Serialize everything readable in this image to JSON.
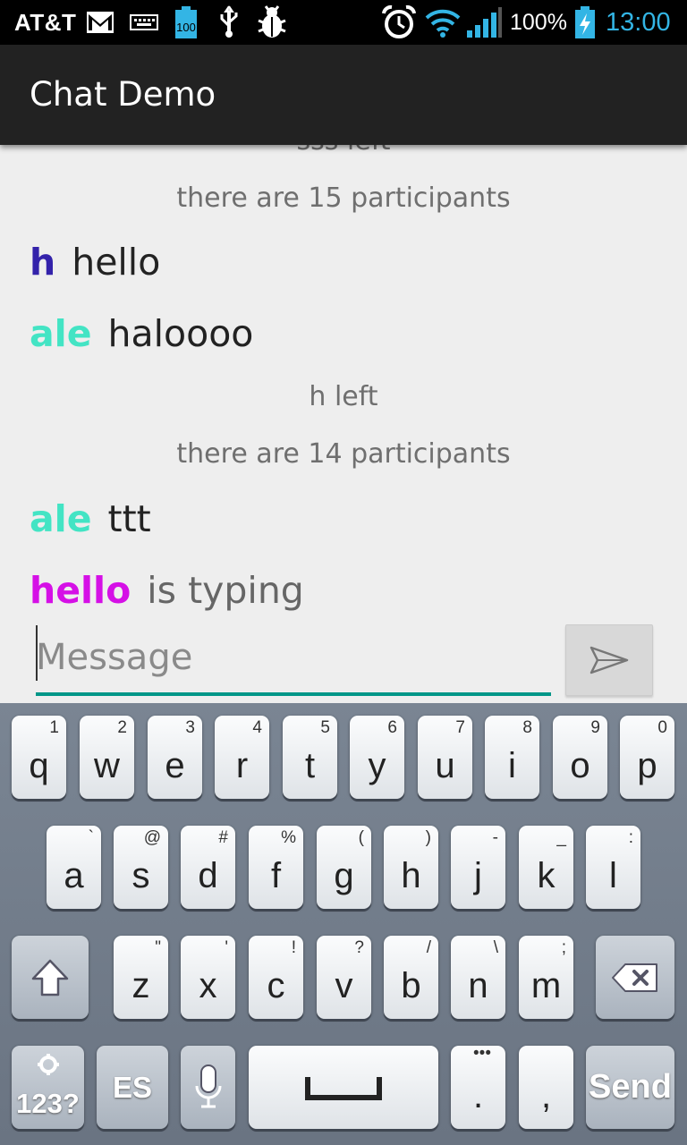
{
  "status_bar": {
    "carrier": "AT&T",
    "icons": [
      "gmail-icon",
      "keyboard-icon",
      "battery-100-icon",
      "usb-icon",
      "debug-icon",
      "alarm-icon",
      "wifi-icon",
      "signal-icon",
      "battery-charging-icon"
    ],
    "notification_battery_level": "100",
    "battery": "100%",
    "time": "13:00",
    "time_color": "#33b5e5"
  },
  "action_bar": {
    "title": "Chat Demo"
  },
  "chat": {
    "clipped_top": "sss left",
    "items": [
      {
        "type": "system",
        "text": "there are 15 participants"
      },
      {
        "type": "message",
        "user": "h",
        "user_color": "#3322aa",
        "text": "hello"
      },
      {
        "type": "message",
        "user": "ale",
        "user_color": "#43e4c4",
        "text": "haloooo"
      },
      {
        "type": "system",
        "text": "h left"
      },
      {
        "type": "system",
        "text": "there are 14 participants"
      },
      {
        "type": "message",
        "user": "ale",
        "user_color": "#43e4c4",
        "text": "ttt"
      }
    ],
    "typing": {
      "user": "hello",
      "user_color": "#d510e6",
      "text": "is typing"
    }
  },
  "composer": {
    "placeholder": "Message",
    "value": "",
    "send_icon": "send-icon"
  },
  "keyboard": {
    "row1": [
      {
        "main": "q",
        "sub": "1"
      },
      {
        "main": "w",
        "sub": "2"
      },
      {
        "main": "e",
        "sub": "3"
      },
      {
        "main": "r",
        "sub": "4"
      },
      {
        "main": "t",
        "sub": "5"
      },
      {
        "main": "y",
        "sub": "6"
      },
      {
        "main": "u",
        "sub": "7"
      },
      {
        "main": "i",
        "sub": "8"
      },
      {
        "main": "o",
        "sub": "9"
      },
      {
        "main": "p",
        "sub": "0"
      }
    ],
    "row2": [
      {
        "main": "a",
        "sub": "`"
      },
      {
        "main": "s",
        "sub": "@"
      },
      {
        "main": "d",
        "sub": "#"
      },
      {
        "main": "f",
        "sub": "%"
      },
      {
        "main": "g",
        "sub": "("
      },
      {
        "main": "h",
        "sub": ")"
      },
      {
        "main": "j",
        "sub": "-"
      },
      {
        "main": "k",
        "sub": "_"
      },
      {
        "main": "l",
        "sub": ":"
      }
    ],
    "row3": [
      {
        "main": "z",
        "sub": "\""
      },
      {
        "main": "x",
        "sub": "'"
      },
      {
        "main": "c",
        "sub": "!"
      },
      {
        "main": "v",
        "sub": "?"
      },
      {
        "main": "b",
        "sub": "/"
      },
      {
        "main": "n",
        "sub": "\\"
      },
      {
        "main": "m",
        "sub": ";"
      }
    ],
    "shift_icon": "shift-icon",
    "backspace_icon": "backspace-icon",
    "symbols_label": "123?",
    "language_label": "ES",
    "mic_icon": "microphone-icon",
    "space_icon": "space-bar-icon",
    "period_label": ".",
    "comma_label": ",",
    "send_label": "Send"
  }
}
